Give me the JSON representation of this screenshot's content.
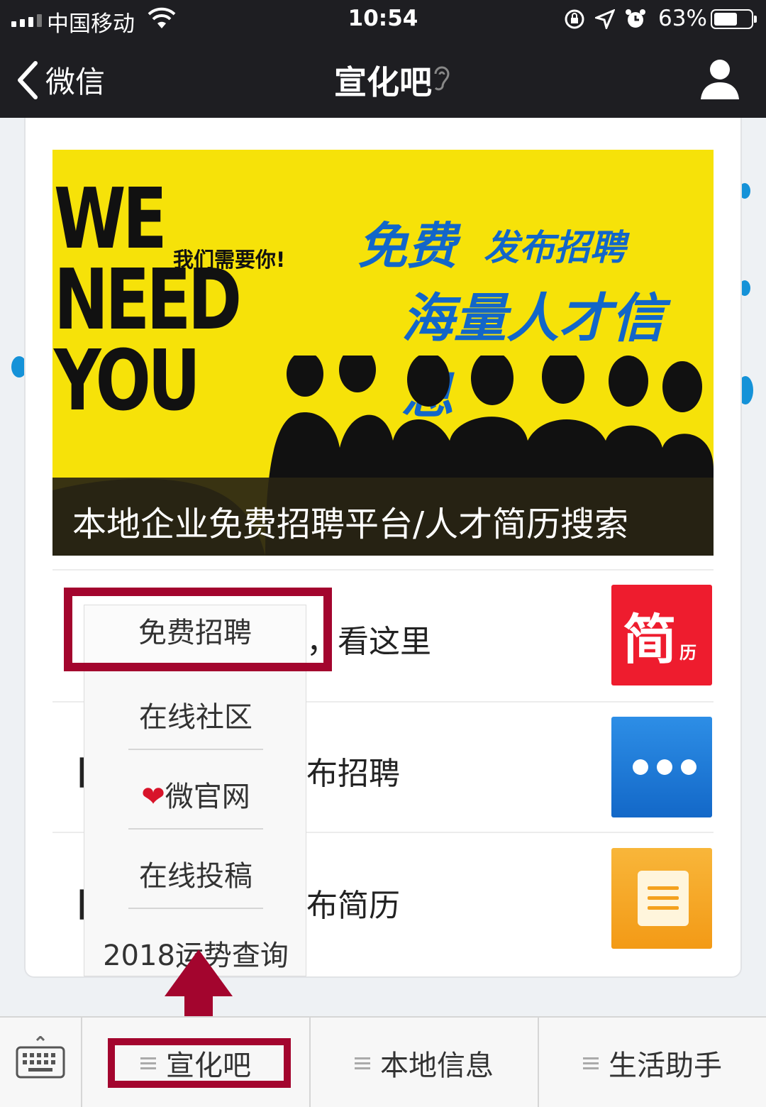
{
  "status": {
    "carrier": "中国移动",
    "time": "10:54",
    "battery_pct": "63%",
    "battery_level": 0.63
  },
  "nav": {
    "back_label": "微信",
    "title": "宣化吧"
  },
  "banner": {
    "we_lines": [
      "WE",
      "NEED",
      "YOU"
    ],
    "we_need_cn": "我们需要你!",
    "free_a": "免费",
    "free_b": "发布招聘",
    "line2": "海量人才信息",
    "caption": "本地企业免费招聘平台/人才简历搜索"
  },
  "rows": {
    "row1_text": "，看这里",
    "row2_bracket": "【",
    "row2_text": "布招聘",
    "row3_bracket": "【",
    "row3_text": "布简历",
    "tile1_big": "简",
    "tile1_small": "历"
  },
  "menu": {
    "items": [
      "免费招聘",
      "在线社区",
      "微官网",
      "在线投稿",
      "2018运势查询"
    ]
  },
  "tabbar": {
    "tabs": [
      "宣化吧",
      "本地信息",
      "生活助手"
    ]
  },
  "colors": {
    "highlight": "#a3052e",
    "banner_yellow": "#f6e209",
    "banner_blue": "#1266c9"
  }
}
